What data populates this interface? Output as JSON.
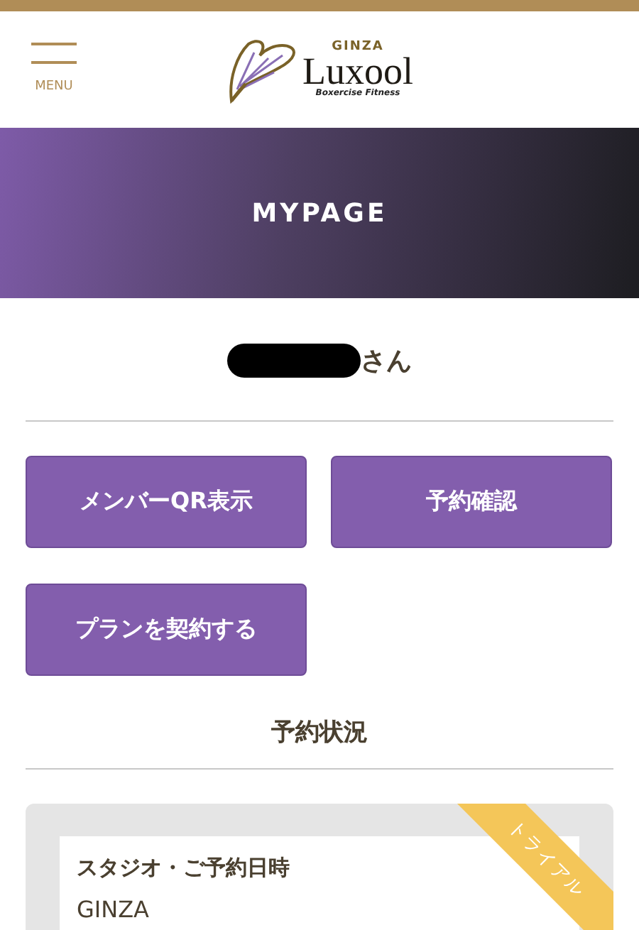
{
  "header": {
    "menu_label": "MENU",
    "logo": {
      "area": "GINZA",
      "brand": "Luxool",
      "tagline": "Boxercise Fitness"
    }
  },
  "hero": {
    "title": "MYPAGE"
  },
  "user": {
    "honorific": "さん"
  },
  "actions": [
    {
      "label": "メンバーQR表示"
    },
    {
      "label": "予約確認"
    },
    {
      "label": "プランを契約する"
    }
  ],
  "reservations": {
    "heading": "予約状況",
    "card": {
      "ribbon": "トライアル",
      "label": "スタジオ・ご予約日時",
      "studio": "GINZA"
    }
  }
}
